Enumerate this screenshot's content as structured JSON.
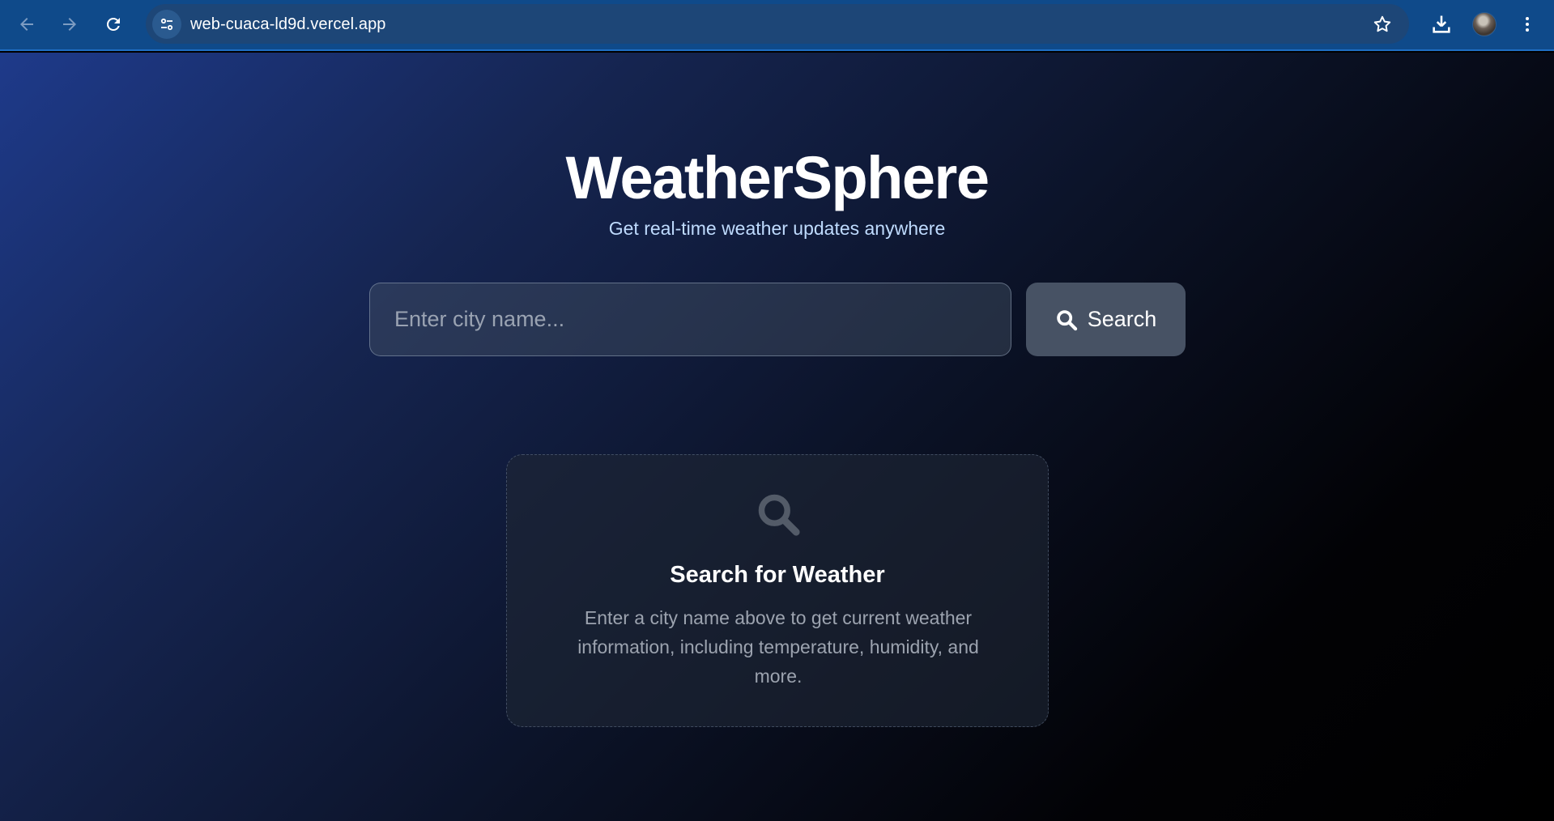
{
  "browser": {
    "url": "web-cuaca-ld9d.vercel.app",
    "icons": [
      "back-icon",
      "forward-icon",
      "reload-icon",
      "site-info-icon",
      "star-icon",
      "download-icon",
      "avatar",
      "menu-icon"
    ]
  },
  "app": {
    "title": "WeatherSphere",
    "subtitle": "Get real-time weather updates anywhere"
  },
  "search": {
    "placeholder": "Enter city name...",
    "value": "",
    "button_label": "Search"
  },
  "empty_state": {
    "title": "Search for Weather",
    "text": "Enter a city name above to get current weather information, including temperature, humidity, and more."
  },
  "colors": {
    "accent": "#1e3a8a",
    "subtitle": "#bfdbfe",
    "button": "#475264"
  }
}
